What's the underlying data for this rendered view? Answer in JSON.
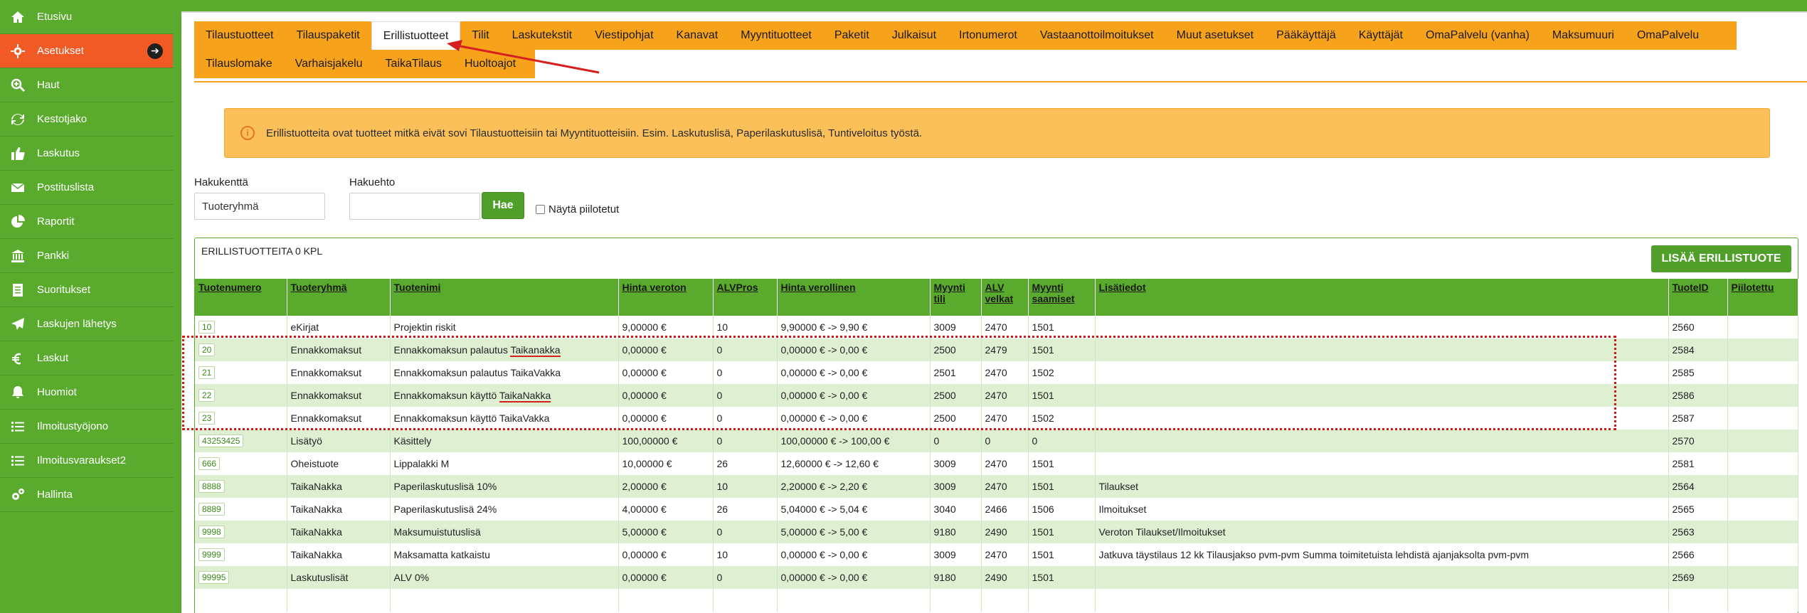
{
  "sidebar": {
    "items": [
      {
        "label": "Etusivu",
        "icon": "home-icon"
      },
      {
        "label": "Asetukset",
        "icon": "gear-icon",
        "active": true
      },
      {
        "label": "Haut",
        "icon": "search-plus-icon"
      },
      {
        "label": "Kestotjako",
        "icon": "refresh-icon"
      },
      {
        "label": "Laskutus",
        "icon": "thumbs-up-icon"
      },
      {
        "label": "Postituslista",
        "icon": "envelope-icon"
      },
      {
        "label": "Raportit",
        "icon": "pie-chart-icon"
      },
      {
        "label": "Pankki",
        "icon": "bank-icon"
      },
      {
        "label": "Suoritukset",
        "icon": "document-icon"
      },
      {
        "label": "Laskujen lähetys",
        "icon": "paper-plane-icon"
      },
      {
        "label": "Laskut",
        "icon": "euro-icon"
      },
      {
        "label": "Huomiot",
        "icon": "bell-icon"
      },
      {
        "label": "Ilmoitustyöjono",
        "icon": "list-icon"
      },
      {
        "label": "Ilmoitusvaraukset2",
        "icon": "list-icon"
      },
      {
        "label": "Hallinta",
        "icon": "cogs-icon"
      }
    ]
  },
  "tabs": {
    "row1": [
      "Tilaustuotteet",
      "Tilauspaketit",
      "Erillistuotteet",
      "Tilit",
      "Laskutekstit",
      "Viestipohjat",
      "Kanavat",
      "Myyntituotteet",
      "Paketit",
      "Julkaisut",
      "Irtonumerot",
      "Vastaanottoilmoitukset",
      "Muut asetukset",
      "Pääkäyttäjä",
      "Käyttäjät",
      "OmaPalvelu (vanha)",
      "Maksumuuri",
      "OmaPalvelu"
    ],
    "row2": [
      "Tilauslomake",
      "Varhaisjakelu",
      "TaikaTilaus",
      "Huoltoajot"
    ],
    "active": "Erillistuotteet"
  },
  "info": {
    "text": "Erillistuotteita ovat tuotteet mitkä eivät sovi Tilaustuotteisiin tai Myyntituotteisiin. Esim. Laskutuslisä, Paperilaskutuslisä, Tuntiveloitus työstä."
  },
  "search": {
    "field_label": "Hakukenttä",
    "field_value": "Tuoteryhmä",
    "term_label": "Hakuehto",
    "term_value": "",
    "button": "Hae",
    "show_hidden": "Näytä piilotetut"
  },
  "list": {
    "count_text": "ERILLISTUOTTEITA 0 KPL",
    "add_button": "LISÄÄ ERILLISTUOTE"
  },
  "table": {
    "headers": [
      "Tuotenumero",
      "Tuoteryhmä",
      "Tuotenimi",
      "Hinta veroton",
      "ALVPros",
      "Hinta verollinen",
      "Myynti tili",
      "ALV velkat",
      "Myynti saamiset",
      "Lisätiedot",
      "TuoteID",
      "Piilotettu"
    ],
    "rows": [
      [
        "10",
        "eKirjat",
        "Projektin riskit",
        "9,00000 €",
        "10",
        "9,90000 € -> 9,90 €",
        "3009",
        "2470",
        "1501",
        "",
        "2560",
        ""
      ],
      [
        "20",
        "Ennakkomaksut",
        "Ennakkomaksun palautus Taikanakka",
        "0,00000 €",
        "0",
        "0,00000 € -> 0,00 €",
        "2500",
        "2479",
        "1501",
        "",
        "2584",
        ""
      ],
      [
        "21",
        "Ennakkomaksut",
        "Ennakkomaksun palautus TaikaVakka",
        "0,00000 €",
        "0",
        "0,00000 € -> 0,00 €",
        "2501",
        "2470",
        "1502",
        "",
        "2585",
        ""
      ],
      [
        "22",
        "Ennakkomaksut",
        "Ennakkomaksun käyttö TaikaNakka",
        "0,00000 €",
        "0",
        "0,00000 € -> 0,00 €",
        "2500",
        "2470",
        "1501",
        "",
        "2586",
        ""
      ],
      [
        "23",
        "Ennakkomaksut",
        "Ennakkomaksun käyttö TaikaVakka",
        "0,00000 €",
        "0",
        "0,00000 € -> 0,00 €",
        "2500",
        "2470",
        "1502",
        "",
        "2587",
        ""
      ],
      [
        "43253425",
        "Lisätyö",
        "Käsittely",
        "100,00000 €",
        "0",
        "100,00000 € -> 100,00 €",
        "0",
        "0",
        "0",
        "",
        "2570",
        ""
      ],
      [
        "666",
        "Oheistuote",
        "Lippalakki M",
        "10,00000 €",
        "26",
        "12,60000 € -> 12,60 €",
        "3009",
        "2470",
        "1501",
        "",
        "2581",
        ""
      ],
      [
        "8888",
        "TaikaNakka",
        "Paperilaskutuslisä 10%",
        "2,00000 €",
        "10",
        "2,20000 € -> 2,20 €",
        "3009",
        "2470",
        "1501",
        "Tilaukset",
        "2564",
        ""
      ],
      [
        "8889",
        "TaikaNakka",
        "Paperilaskutuslisä 24%",
        "4,00000 €",
        "26",
        "5,04000 € -> 5,04 €",
        "3040",
        "2466",
        "1506",
        "Ilmoitukset",
        "2565",
        ""
      ],
      [
        "9998",
        "TaikaNakka",
        "Maksumuistutuslisä",
        "5,00000 €",
        "0",
        "5,00000 € -> 5,00 €",
        "9180",
        "2490",
        "1501",
        "Veroton Tilaukset/Ilmoitukset",
        "2563",
        ""
      ],
      [
        "9999",
        "TaikaNakka",
        "Maksamatta katkaistu",
        "0,00000 €",
        "10",
        "0,00000 € -> 0,00 €",
        "3009",
        "2470",
        "1501",
        "Jatkuva täystilaus 12 kk Tilausjakso pvm-pvm Summa toimitetuista lehdistä ajanjaksolta pvm-pvm",
        "2566",
        ""
      ],
      [
        "99995",
        "Laskutuslisät",
        "ALV 0%",
        "0,00000 €",
        "0",
        "0,00000 € -> 0,00 €",
        "9180",
        "2490",
        "1501",
        "",
        "2569",
        ""
      ],
      [
        "",
        "",
        "",
        "",
        "",
        "",
        "",
        "",
        "",
        "",
        "",
        ""
      ]
    ]
  },
  "colors": {
    "green": "#5aaa2e",
    "orange_tab": "#f7a21b",
    "active_side": "#f15a24",
    "info_bg": "#fbc05a",
    "annotation_red": "#cc1a1a"
  }
}
